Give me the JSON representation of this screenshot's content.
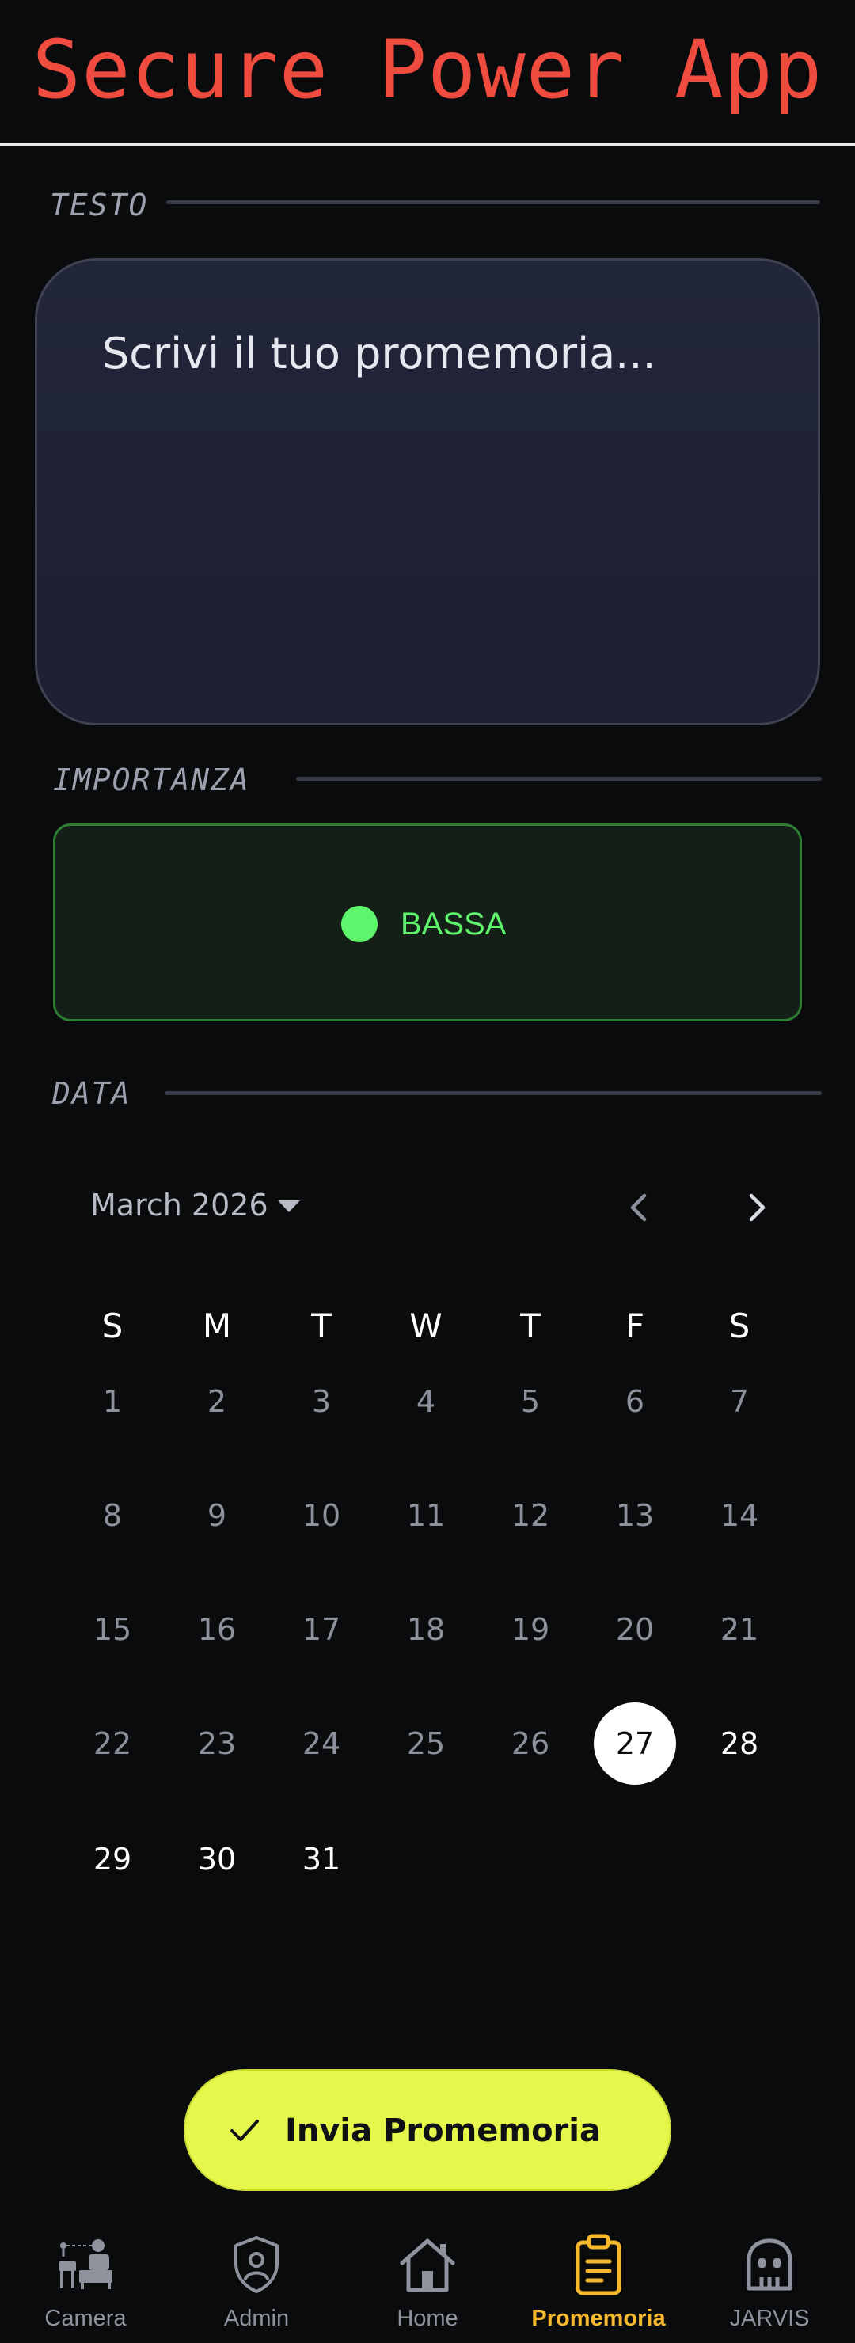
{
  "app": {
    "title": "Secure Power App"
  },
  "sections": {
    "text_label": "TESTO",
    "importance_label": "IMPORTANZA",
    "date_label": "DATA"
  },
  "reminder_input": {
    "placeholder": "Scrivi il tuo promemoria..."
  },
  "importance": {
    "value": "BASSA",
    "color": "#5ef56c"
  },
  "calendar": {
    "month_label": "March 2026",
    "weekdays": [
      "S",
      "M",
      "T",
      "W",
      "T",
      "F",
      "S"
    ],
    "first_weekday_index": 0,
    "days_in_month": 31,
    "selected_day": 27
  },
  "submit": {
    "label": "Invia Promemoria"
  },
  "bottom_nav": {
    "items": [
      {
        "label": "Camera",
        "icon": "camera-monitor-icon",
        "active": false
      },
      {
        "label": "Admin",
        "icon": "shield-user-icon",
        "active": false
      },
      {
        "label": "Home",
        "icon": "home-icon",
        "active": false
      },
      {
        "label": "Promemoria",
        "icon": "clipboard-icon",
        "active": true
      },
      {
        "label": "JARVIS",
        "icon": "robot-icon",
        "active": false
      }
    ]
  },
  "colors": {
    "title": "#ef4c3f",
    "accent_button": "#e6f74c",
    "active_nav": "#f5b82e",
    "background": "#0a0b0d"
  }
}
